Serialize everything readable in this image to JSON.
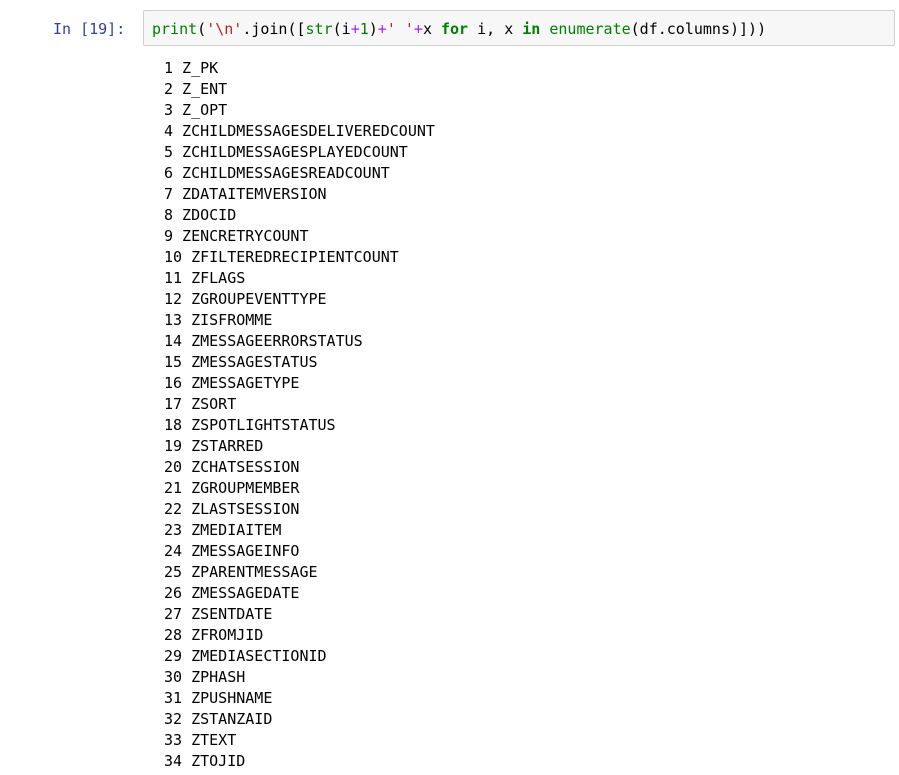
{
  "cell": {
    "prompt": "In [19]:",
    "code_tokens": [
      {
        "text": "print",
        "kind": "builtin"
      },
      {
        "text": "(",
        "kind": "plain"
      },
      {
        "text": "'\\n'",
        "kind": "string"
      },
      {
        "text": ".join([",
        "kind": "plain"
      },
      {
        "text": "str",
        "kind": "builtin"
      },
      {
        "text": "(i",
        "kind": "plain"
      },
      {
        "text": "+",
        "kind": "op"
      },
      {
        "text": "1",
        "kind": "number"
      },
      {
        "text": ")",
        "kind": "plain"
      },
      {
        "text": "+",
        "kind": "op"
      },
      {
        "text": "' '",
        "kind": "string"
      },
      {
        "text": "+",
        "kind": "op"
      },
      {
        "text": "x ",
        "kind": "plain"
      },
      {
        "text": "for",
        "kind": "kw"
      },
      {
        "text": " i, x ",
        "kind": "plain"
      },
      {
        "text": "in",
        "kind": "kw"
      },
      {
        "text": " ",
        "kind": "plain"
      },
      {
        "text": "enumerate",
        "kind": "builtin"
      },
      {
        "text": "(df.columns)]))",
        "kind": "plain"
      }
    ],
    "output_lines": [
      "1 Z_PK",
      "2 Z_ENT",
      "3 Z_OPT",
      "4 ZCHILDMESSAGESDELIVEREDCOUNT",
      "5 ZCHILDMESSAGESPLAYEDCOUNT",
      "6 ZCHILDMESSAGESREADCOUNT",
      "7 ZDATAITEMVERSION",
      "8 ZDOCID",
      "9 ZENCRETRYCOUNT",
      "10 ZFILTEREDRECIPIENTCOUNT",
      "11 ZFLAGS",
      "12 ZGROUPEVENTTYPE",
      "13 ZISFROMME",
      "14 ZMESSAGEERRORSTATUS",
      "15 ZMESSAGESTATUS",
      "16 ZMESSAGETYPE",
      "17 ZSORT",
      "18 ZSPOTLIGHTSTATUS",
      "19 ZSTARRED",
      "20 ZCHATSESSION",
      "21 ZGROUPMEMBER",
      "22 ZLASTSESSION",
      "23 ZMEDIAITEM",
      "24 ZMESSAGEINFO",
      "25 ZPARENTMESSAGE",
      "26 ZMESSAGEDATE",
      "27 ZSENTDATE",
      "28 ZFROMJID",
      "29 ZMEDIASECTIONID",
      "30 ZPHASH",
      "31 ZPUSHNAME",
      "32 ZSTANZAID",
      "33 ZTEXT",
      "34 ZTOJID"
    ]
  }
}
